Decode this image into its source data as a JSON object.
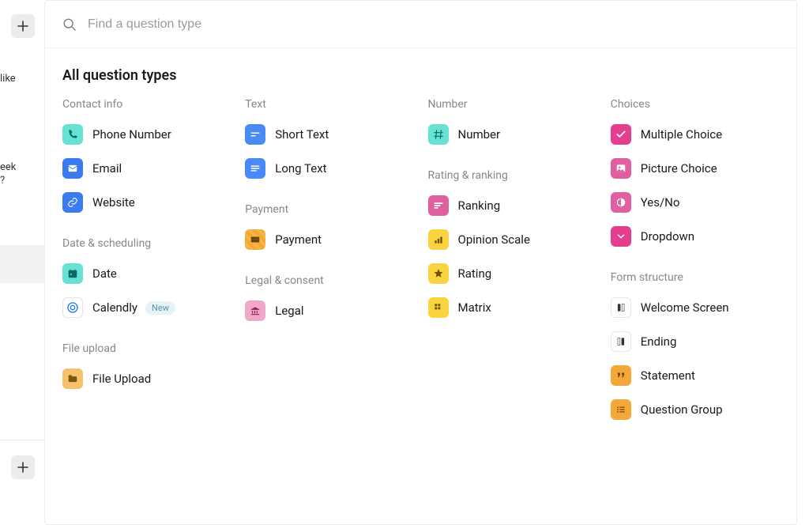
{
  "side": {
    "truncated1": "like",
    "truncated2": "eek",
    "truncated3": "?"
  },
  "search": {
    "placeholder": "Find a question type"
  },
  "panel": {
    "title": "All question types"
  },
  "groups": {
    "contact": {
      "header": "Contact info",
      "items": {
        "phone": "Phone Number",
        "email": "Email",
        "website": "Website"
      }
    },
    "date": {
      "header": "Date & scheduling",
      "items": {
        "date": "Date",
        "calendly": "Calendly"
      },
      "badge": "New"
    },
    "file": {
      "header": "File upload",
      "items": {
        "file": "File Upload"
      }
    },
    "text": {
      "header": "Text",
      "items": {
        "short": "Short Text",
        "long": "Long Text"
      }
    },
    "payment": {
      "header": "Payment",
      "items": {
        "payment": "Payment"
      }
    },
    "legal": {
      "header": "Legal & consent",
      "items": {
        "legal": "Legal"
      }
    },
    "number": {
      "header": "Number",
      "items": {
        "number": "Number"
      }
    },
    "rating": {
      "header": "Rating & ranking",
      "items": {
        "ranking": "Ranking",
        "opinion": "Opinion Scale",
        "rating": "Rating",
        "matrix": "Matrix"
      }
    },
    "choices": {
      "header": "Choices",
      "items": {
        "multiple": "Multiple Choice",
        "picture": "Picture Choice",
        "yesno": "Yes/No",
        "dropdown": "Dropdown"
      }
    },
    "structure": {
      "header": "Form structure",
      "items": {
        "welcome": "Welcome Screen",
        "ending": "Ending",
        "statement": "Statement",
        "group": "Question Group"
      }
    }
  }
}
